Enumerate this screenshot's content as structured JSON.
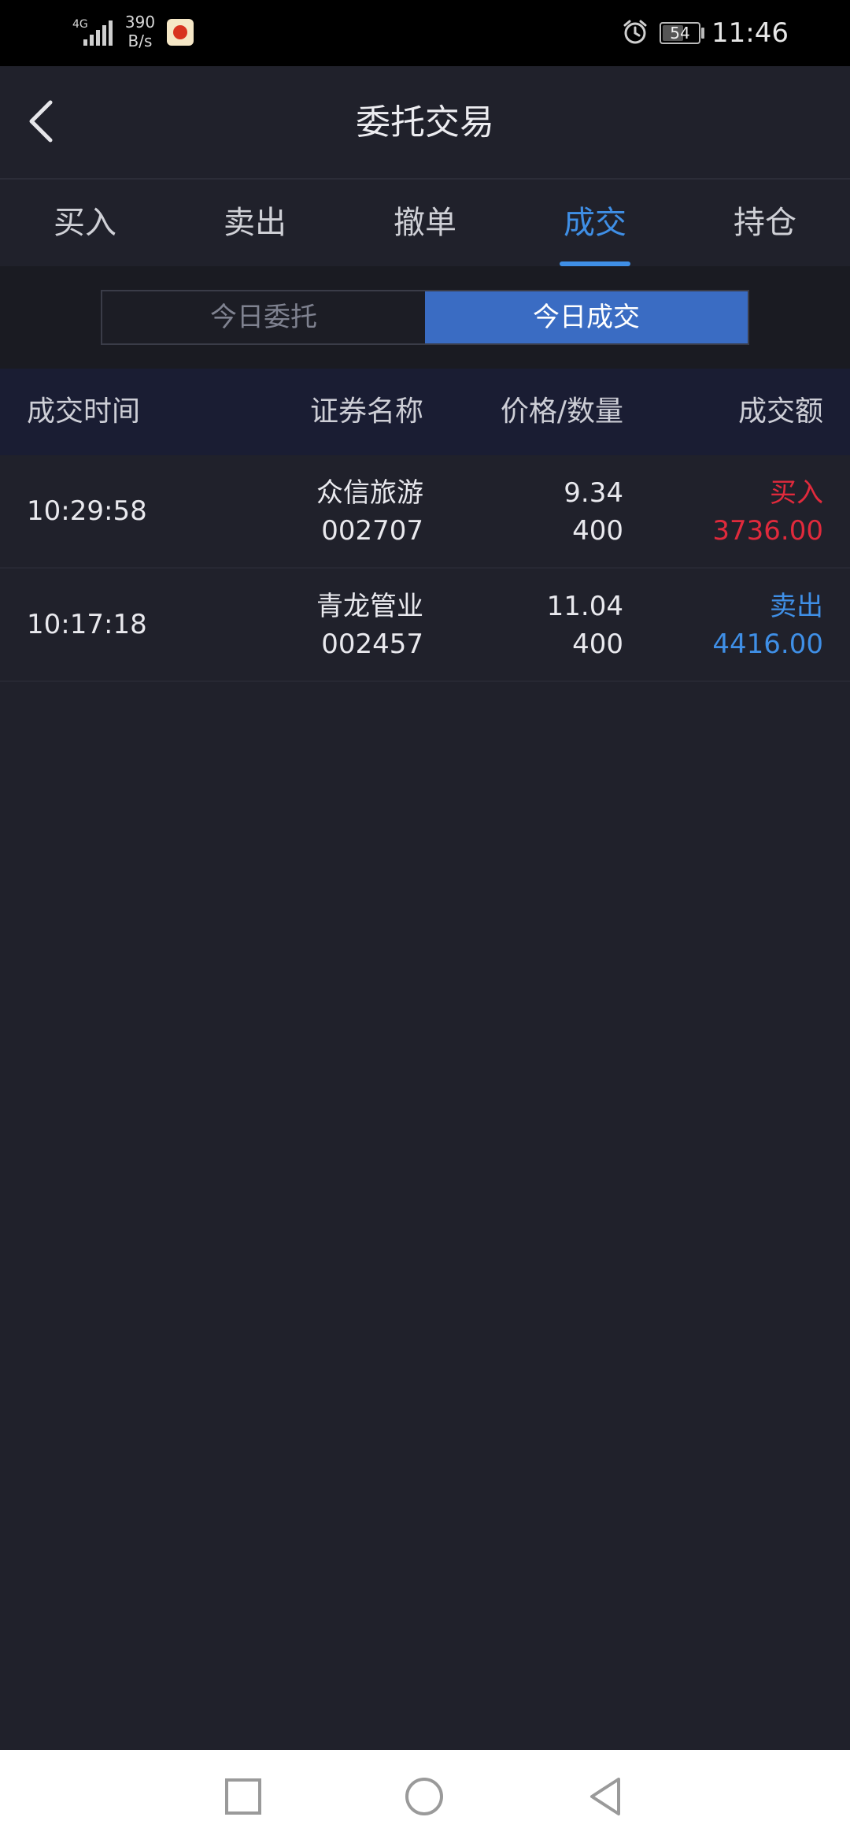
{
  "status_bar": {
    "network": "4G",
    "speed_value": "390",
    "speed_unit": "B/s",
    "battery": "54",
    "time": "11:46"
  },
  "header": {
    "title": "委托交易"
  },
  "tabs": [
    {
      "label": "买入"
    },
    {
      "label": "卖出"
    },
    {
      "label": "撤单"
    },
    {
      "label": "成交",
      "active": true
    },
    {
      "label": "持仓"
    }
  ],
  "segments": [
    {
      "label": "今日委托"
    },
    {
      "label": "今日成交",
      "active": true
    }
  ],
  "table": {
    "columns": [
      "成交时间",
      "证券名称",
      "价格/数量",
      "成交额"
    ],
    "rows": [
      {
        "time": "10:29:58",
        "name": "众信旅游",
        "code": "002707",
        "price": "9.34",
        "qty": "400",
        "side": "买入",
        "amount": "3736.00"
      },
      {
        "time": "10:17:18",
        "name": "青龙管业",
        "code": "002457",
        "price": "11.04",
        "qty": "400",
        "side": "卖出",
        "amount": "4416.00"
      }
    ]
  },
  "colors": {
    "background": "#20212b",
    "accent": "#3f8fe6",
    "buy": "#e02a3c",
    "sell": "#3f8fe6",
    "segment_active": "#3a6cc3",
    "table_header": "#1a1d33"
  }
}
